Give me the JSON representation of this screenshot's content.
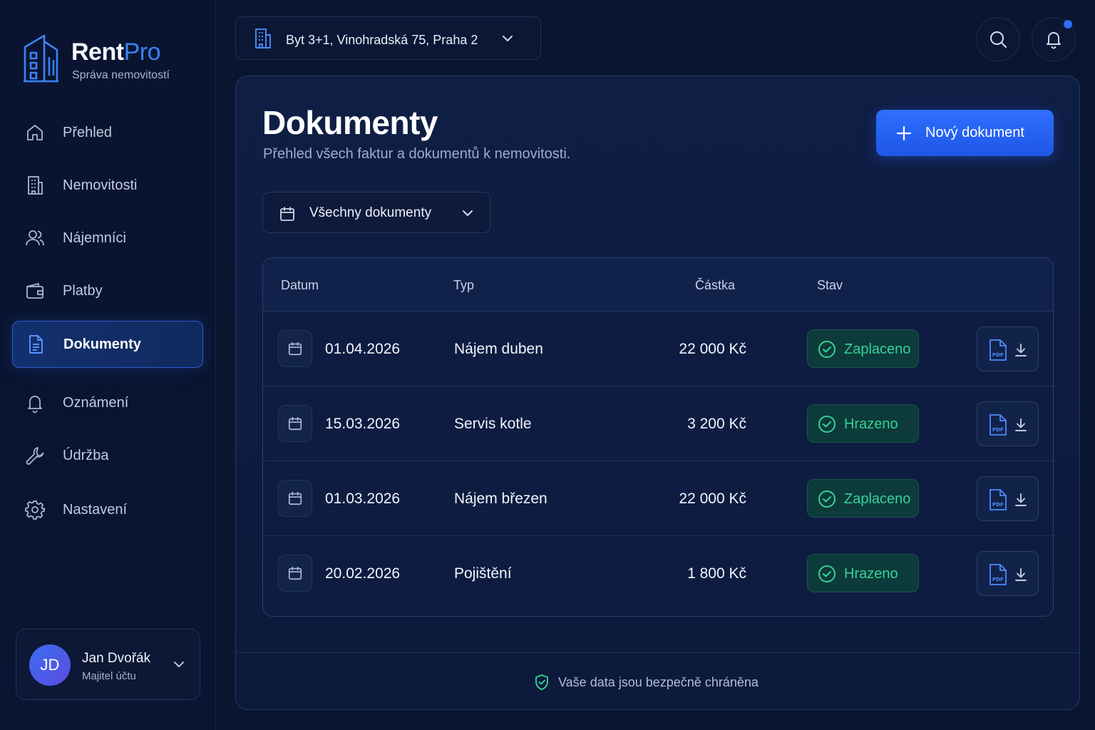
{
  "app": {
    "brand_primary": "Rent",
    "brand_secondary": "Pro",
    "tagline": "Správa nemovitostí",
    "accent_color": "#2f6bff",
    "success_color": "#34d399"
  },
  "sidebar": {
    "items": [
      {
        "label": "Přehled",
        "icon": "home-icon",
        "active": false
      },
      {
        "label": "Nemovitosti",
        "icon": "building-icon",
        "active": false
      },
      {
        "label": "Nájemníci",
        "icon": "users-icon",
        "active": false
      },
      {
        "label": "Platby",
        "icon": "wallet-icon",
        "active": false
      },
      {
        "label": "Dokumenty",
        "icon": "document-icon",
        "active": true
      },
      {
        "label": "Oznámení",
        "icon": "bell-icon",
        "active": false
      },
      {
        "label": "Údržba",
        "icon": "wrench-icon",
        "active": false
      },
      {
        "label": "Nastavení",
        "icon": "gear-icon",
        "active": false
      }
    ]
  },
  "user": {
    "initials": "JD",
    "name": "Jan Dvořák",
    "role": "Majitel účtu"
  },
  "topbar": {
    "property": "Byt 3+1, Vinohradská 75, Praha 2",
    "has_notifications": true
  },
  "main": {
    "title": "Dokumenty",
    "subtitle": "Přehled všech faktur a dokumentů k nemovitosti.",
    "new_button": "Nový dokument",
    "filter": "Všechny dokumenty",
    "columns": [
      "Datum",
      "Typ",
      "Částka",
      "Stav"
    ],
    "rows": [
      {
        "date": "01.04.2026",
        "type": "Nájem duben",
        "amount": "22 000 Kč",
        "status": "Zaplaceno"
      },
      {
        "date": "15.03.2026",
        "type": "Servis kotle",
        "amount": "3 200 Kč",
        "status": "Hrazeno"
      },
      {
        "date": "01.03.2026",
        "type": "Nájem březen",
        "amount": "22 000 Kč",
        "status": "Zaplaceno"
      },
      {
        "date": "20.02.2026",
        "type": "Pojištění",
        "amount": "1 800 Kč",
        "status": "Hrazeno"
      }
    ],
    "security_note": "Vaše data jsou bezpečně chráněna"
  }
}
